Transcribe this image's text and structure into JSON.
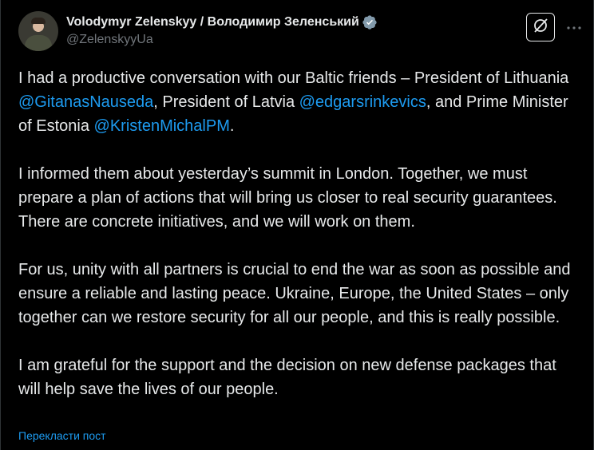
{
  "author": {
    "display_name": "Volodymyr Zelenskyy / Володимир Зеленський",
    "handle": "@ZelenskyyUa",
    "verified": true
  },
  "header_actions": {
    "grok_icon": "grok-slash-icon",
    "more_icon": "more-dots-icon"
  },
  "post": {
    "paragraphs": [
      {
        "segments": [
          {
            "text": "I had a productive conversation with our Baltic friends – President of Lithuania ",
            "type": "text"
          },
          {
            "text": "@GitanasNauseda",
            "type": "mention"
          },
          {
            "text": ", President of Latvia ",
            "type": "text"
          },
          {
            "text": "@edgarsrinkevics",
            "type": "mention"
          },
          {
            "text": ", and Prime Minister of Estonia ",
            "type": "text"
          },
          {
            "text": "@KristenMichalPM",
            "type": "mention"
          },
          {
            "text": ".",
            "type": "text"
          }
        ]
      },
      {
        "segments": [
          {
            "text": "I informed them about yesterday’s summit in London. Together, we must prepare a plan of actions that will bring us closer to real security guarantees. There are concrete initiatives, and we will work on them.",
            "type": "text"
          }
        ]
      },
      {
        "segments": [
          {
            "text": "For us, unity with all partners is crucial to end the war as soon as possible and ensure a reliable and lasting peace. Ukraine, Europe, the United States – only together can we restore security for all our people, and this is really possible.",
            "type": "text"
          }
        ]
      },
      {
        "segments": [
          {
            "text": "I am grateful for the support and the decision on new defense packages that will help save the lives of our people.",
            "type": "text"
          }
        ]
      }
    ]
  },
  "translate_label": "Перекласти пост",
  "colors": {
    "background": "#000000",
    "text": "#e7e9ea",
    "secondary_text": "#71767b",
    "link": "#1d9bf0"
  }
}
